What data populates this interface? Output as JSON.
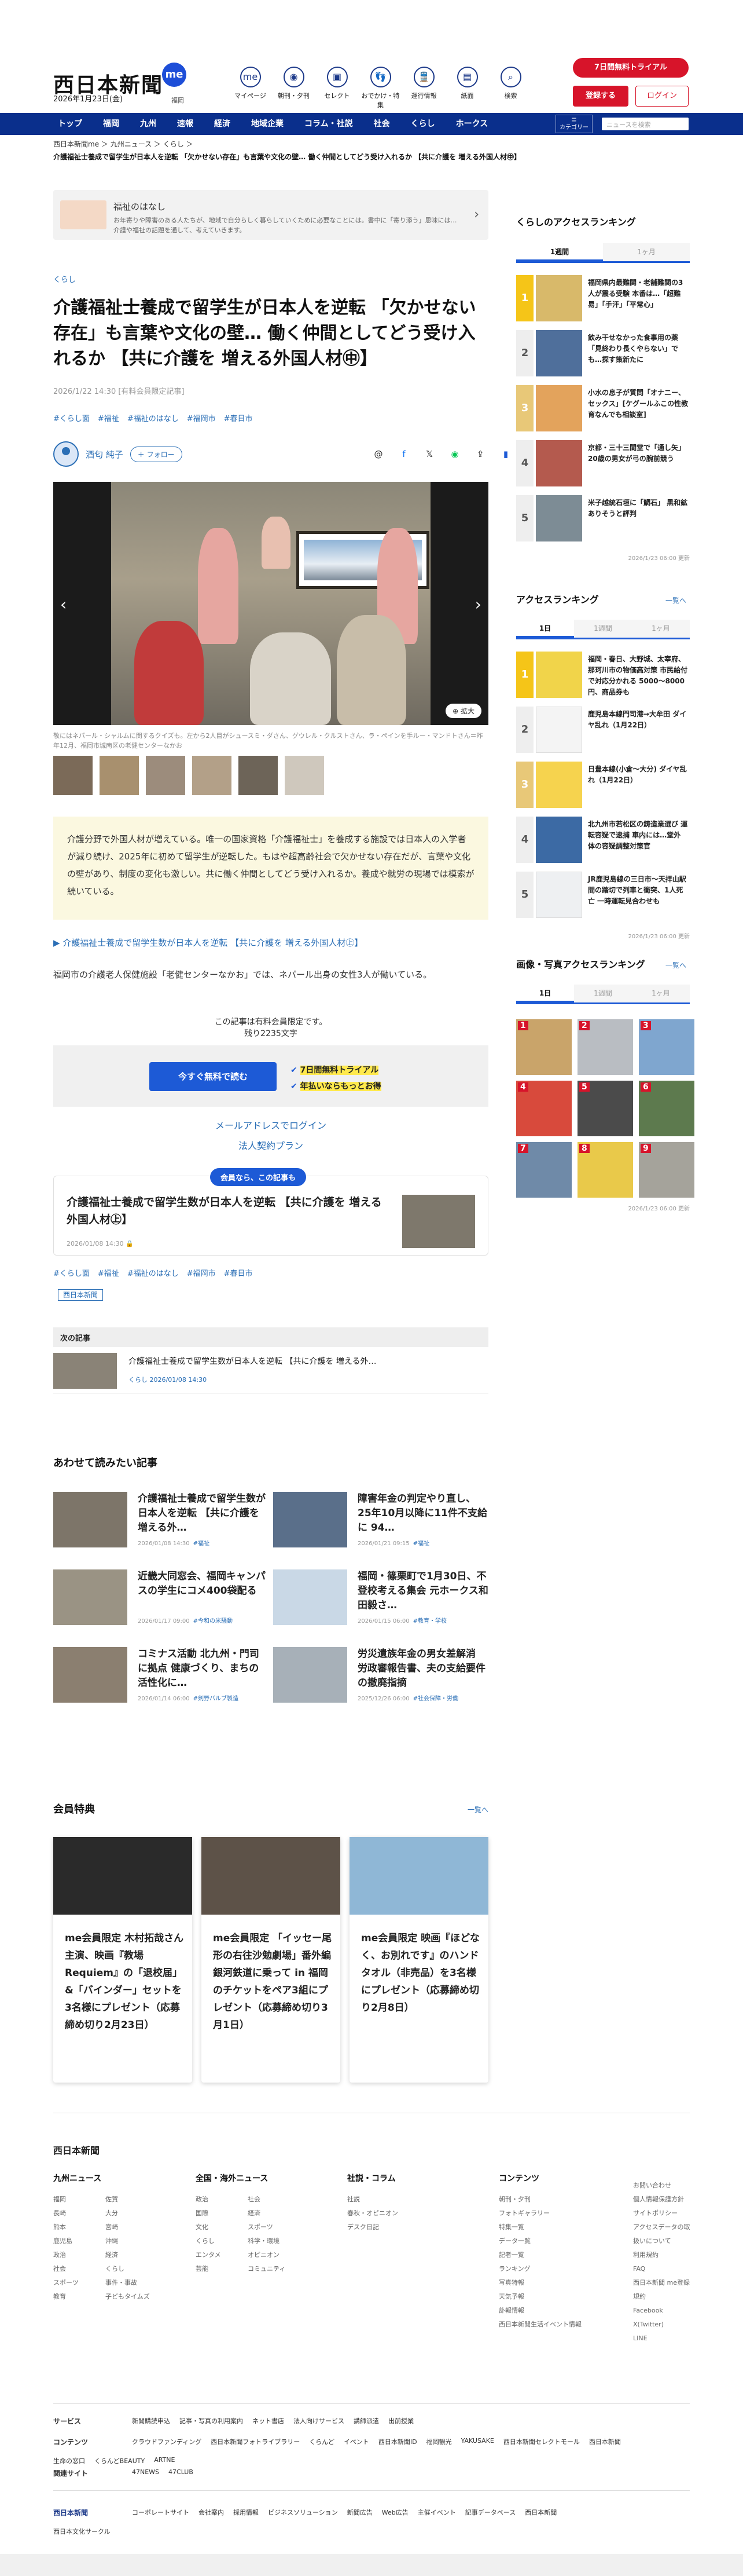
{
  "header": {
    "logo": "西日本新聞",
    "me": "me",
    "date": "2026年1月23日(金)",
    "fukushi": "福岡",
    "icons": [
      {
        "icon": "me-icon",
        "label": "マイページ"
      },
      {
        "icon": "newspaper-icon",
        "label": "朝刊・夕刊"
      },
      {
        "icon": "select-icon",
        "label": "セレクト"
      },
      {
        "icon": "footprints-icon",
        "label": "おでかけ・特集"
      },
      {
        "icon": "train-icon",
        "label": "運行情報"
      },
      {
        "icon": "panel-icon",
        "label": "紙面"
      },
      {
        "icon": "search-icon",
        "label": "検索"
      }
    ],
    "trial": "7日間無料トライアル",
    "register": "登録する",
    "login": "ログイン"
  },
  "nav": {
    "items": [
      "トップ",
      "福岡",
      "九州",
      "速報",
      "経済",
      "地域企業",
      "コラム・社説",
      "社会",
      "くらし",
      "ホークス"
    ],
    "category": "カテゴリー",
    "search_placeholder": "ニュースを検索"
  },
  "breadcrumb": "西日本新聞me ＞ 九州ニュース ＞ くらし ＞",
  "strip": "介護福祉士養成で留学生が日本人を逆転 「欠かせない存在」も言葉や文化の壁… 働く仲間としてどう受け入れるか 【共に介護を 増える外国人材㊥】",
  "banner": {
    "title": "福祉のはなし",
    "desc": "お年寄りや障害のある人たちが、地域で自分らしく暮らしていくために必要なことには。書中に「寄り添う」思味には…介護や福祉の話題を通して、考えていきます。"
  },
  "article": {
    "category": "くらし",
    "title": "介護福祉士養成で留学生が日本人を逆転 「欠かせない存在」も言葉や文化の壁… 働く仲間としてどう受け入れるか 【共に介護を 増える外国人材㊥】",
    "date": "2026/1/22 14:30 [有料会員限定記事]",
    "tags": [
      "#くらし面",
      "#福祉",
      "#福祉のはなし",
      "#福岡市",
      "#春日市"
    ],
    "author": "酒匂 純子",
    "follow": "＋ フォロー",
    "zoom": "拡大",
    "caption": "敬にはネパール・シャルムに関するクイズも。左から2人目がシュースミ・ダさん、グウレル・クルストさん、ラ・ペインを手ルー・マンドトさん＝昨年12月、福岡市城南区の老健センターなかお",
    "lead": "介護分野で外国人材が増えている。唯一の国家資格「介護福祉士」を養成する施設では日本人の入学者が減り続け、2025年に初めて留学生が逆転した。もはや超高齢社会で欠かせない存在だが、言葉や文化の壁があり、制度の変化も激しい。共に働く仲間としてどう受け入れるか。養成や就労の現場では模索が続いている。",
    "readmore": "▶ 介護福祉士養成で留学生数が日本人を逆転 【共に介護を 増える外国人材㊤】",
    "excerpt": "福岡市の介護老人保健施設「老健センターなかお」では、ネパール出身の女性3人が働いている。",
    "paynote1": "この記事は有料会員限定です。",
    "paynote2": "残り2235文字",
    "freebtn": "今すぐ無料で読む",
    "perk1": "7日間無料トライアル",
    "perk2": "年払いならもっとお得",
    "maillogin": "メールアドレスでログイン",
    "corp": "法人契約プラン",
    "member_pill": "会員なら、この記事も",
    "member_title": "介護福祉士養成で留学生数が日本人を逆転 【共に介護を 増える外国人材㊤】",
    "member_date": "2026/01/08 14:30",
    "tags2": [
      "#くらし面",
      "#福祉",
      "#福祉のはなし",
      "#福岡市",
      "#春日市"
    ],
    "source": "西日本新聞"
  },
  "next": {
    "header": "次の記事",
    "title": "介護福祉士養成で留学生数が日本人を逆転 【共に介護を 増える外…",
    "meta": "くらし 2026/01/08 14:30"
  },
  "related": {
    "header": "あわせて読みたい記事",
    "items": [
      {
        "title": "介護福祉士養成で留学生数が日本人を逆転 【共に介護を 増える外…",
        "date": "2026/01/08 14:30",
        "tag": "#福祉"
      },
      {
        "title": "障害年金の判定やり直し、25年10月以降に11件不支給に 94…",
        "date": "2026/01/21 09:15",
        "tag": "#福祉"
      },
      {
        "title": "近畿大同窓会、福岡キャンパスの学生にコメ400袋配る",
        "date": "2026/01/17 09:00",
        "tag": "#今和の米騒動"
      },
      {
        "title": "福岡・篠栗町で1月30日、不登校考える集会 元ホークス和田毅さ…",
        "date": "2026/01/15 06:00",
        "tag": "#教育・学校"
      },
      {
        "title": "コミナス活動 北九州・門司に拠点 健康づくり、まちの活性化に…",
        "date": "2026/01/14 06:00",
        "tag": "#剣野バルブ製造"
      },
      {
        "title": "労災遺族年金の男女差解消 労政審報告書、夫の支給要件の撤廃指摘",
        "date": "2025/12/26 06:00",
        "tag": "#社会保障・労働"
      }
    ]
  },
  "member_benefits": {
    "header": "会員特典",
    "more": "一覧へ",
    "cards": [
      "me会員限定 木村拓哉さん主演、映画『教場 Requiem』の「退校届」&「バインダー」セットを3名様にプレゼント（応募締め切り2月23日）",
      "me会員限定 「イッセー尾形の右往沙勉劇場」番外編 銀河鉄道に乗って in 福岡 のチケットをペア3組にプレゼント（応募締め切り3月1日）",
      "me会員限定 映画『ほどなく、お別れです』のハンドタオル（非売品）を3名様にプレゼント（応募締め切り2月8日）"
    ]
  },
  "sidebar": {
    "kurashi": {
      "header": "くらしのアクセスランキング",
      "tabs": [
        "1週間",
        "1ヶ月"
      ],
      "items": [
        "福岡県内最難関・老舗難関の3人が震る受験 本番は…「超難易」「手汗」「平常心」",
        "飲み干せなかった食事用の薬「見終わり長くやらない」でも…探す策新たに",
        "小水の息子が質問「オナニー、セックス」[ケグールふこの性教育なんでも相談室]",
        "京都・三十三間堂で「通し矢」 20歳の男女が弓の腕前競う",
        "米子越統石垣に「鯛石」 黒和鉱ありそうと評判"
      ],
      "updated": "2026/1/23 06:00 更新"
    },
    "access": {
      "header": "アクセスランキング",
      "more": "一覧へ",
      "tabs": [
        "1日",
        "1週間",
        "1ヶ月"
      ],
      "items": [
        "福岡・春日、大野城、太宰府、那珂川市の物価高対策 市民給付で対応分かれる 5000～8000円、商品券も",
        "鹿児島本線門司港→大牟田 ダイヤ乱れ（1月22日）",
        "日豊本線(小倉～大分) ダイヤ乱れ（1月22日）",
        "北九州市若松区の鋳造業選び 運転容疑で逮捕 車内には…堂外 体の容疑調整対策官",
        "JR鹿児島線の三日市～天拝山駅間の踏切で列車と衝突、1人死亡 一時運転見合わせも"
      ],
      "updated": "2026/1/23 06:00 更新"
    },
    "photo": {
      "header": "画像・写真アクセスランキング",
      "more": "一覧へ",
      "tabs": [
        "1日",
        "1週間",
        "1ヶ月"
      ],
      "updated": "2026/1/23 06:00 更新"
    }
  },
  "footer": {
    "logo": "西日本新聞",
    "cols": [
      {
        "h": "九州ニュース",
        "items": [
          "福岡",
          "佐賀",
          "長崎",
          "大分",
          "熊本",
          "宮崎",
          "鹿児島",
          "沖縄",
          "政治",
          "経済",
          "社会",
          "くらし",
          "スポーツ",
          "事件・事故",
          "教育",
          "子どもタイムズ"
        ]
      },
      {
        "h": "全国・海外ニュース",
        "items": [
          "政治",
          "社会",
          "国際",
          "経済",
          "文化",
          "スポーツ",
          "くらし",
          "科学・環境",
          "エンタメ",
          "オピニオン",
          "芸能",
          "コミュニティ"
        ]
      },
      {
        "h": "社説・コラム",
        "items": [
          "社説",
          "春秋・オピニオン",
          "デスク日記"
        ]
      },
      {
        "h": "コンテンツ",
        "items": [
          "朝刊・夕刊",
          "フォトギャラリー",
          "特集一覧",
          "データ一覧",
          "記者一覧",
          "ランキング",
          "写真特報",
          "天気予報",
          "訃報情報",
          "西日本新聞生活イベント情報"
        ]
      },
      {
        "h": "",
        "items": [
          "お問い合わせ",
          "個人情報保護方針",
          "サイトポリシー",
          "アクセスデータの取扱いについて",
          "利用規約",
          "FAQ",
          "西日本新聞 me登録規約",
          "Facebook",
          "X(Twitter)",
          "LINE"
        ]
      }
    ],
    "rows": [
      {
        "h": "サービス",
        "items": [
          "新聞購読申込",
          "記事・写真の利用案内",
          "ネット書店",
          "法人向けサービス",
          "講師派遣",
          "出前授業"
        ]
      },
      {
        "h": "コンテンツ",
        "items": [
          "クラウドファンディング",
          "西日本新聞フォトライブラリー",
          "くらんど",
          "イベント",
          "西日本新聞ID",
          "福岡観光",
          "YAKUSAKE",
          "西日本新聞セレクトモール",
          "西日本新聞",
          "生命の窓口",
          "くらんどBEAUTY",
          "ARTNE"
        ]
      },
      {
        "h": "関連サイト",
        "items": [
          "47NEWS",
          "47CLUB"
        ]
      }
    ],
    "bottom": [
      "コーポレートサイト",
      "会社案内",
      "採用情報",
      "ビジネスソリューション",
      "新聞広告",
      "Web広告",
      "主催イベント",
      "記事データベース",
      "西日本新聞",
      "西日本文化サークル"
    ]
  },
  "colors": {
    "nav": "#0a2f8c",
    "accent": "#d7142a",
    "link": "#2b6fb6",
    "button": "#1d5ad6"
  }
}
